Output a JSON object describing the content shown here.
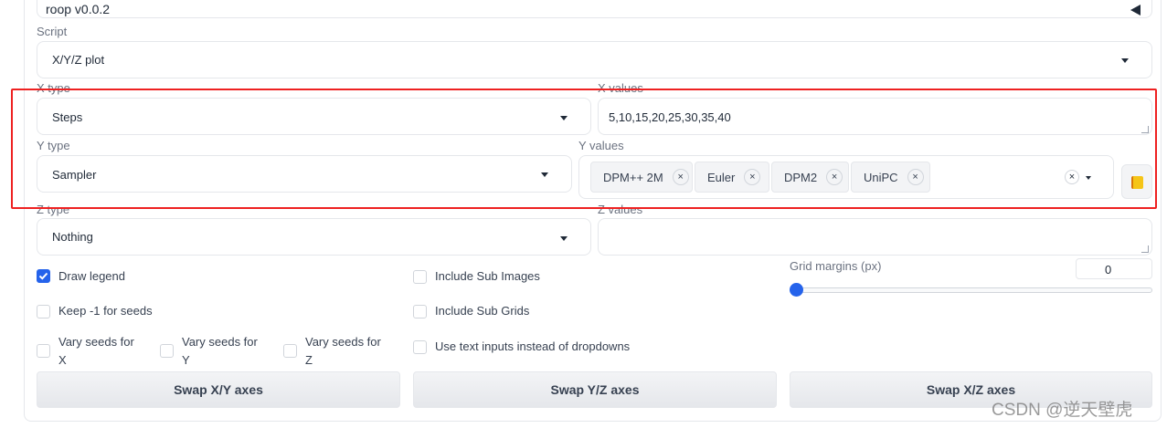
{
  "roop": {
    "label": "roop v0.0.2"
  },
  "script": {
    "label": "Script",
    "value": "X/Y/Z plot"
  },
  "x": {
    "type_label": "X type",
    "type_value": "Steps",
    "values_label": "X values",
    "values_value": "5,10,15,20,25,30,35,40"
  },
  "y": {
    "type_label": "Y type",
    "type_value": "Sampler",
    "values_label": "Y values",
    "chips": [
      "DPM++ 2M",
      "Euler",
      "DPM2",
      "UniPC"
    ],
    "chip_remove": "×",
    "clear": "×"
  },
  "z": {
    "type_label": "Z type",
    "type_value": "Nothing",
    "values_label": "Z values",
    "values_value": ""
  },
  "options": {
    "draw_legend": {
      "label": "Draw legend",
      "checked": true
    },
    "include_sub_images": {
      "label": "Include Sub Images",
      "checked": false
    },
    "keep_seeds": {
      "label": "Keep -1 for seeds",
      "checked": false
    },
    "include_sub_grids": {
      "label": "Include Sub Grids",
      "checked": false
    },
    "vary_x": {
      "label_1": "Vary seeds for",
      "label_2": "X",
      "checked": false
    },
    "vary_y": {
      "label_1": "Vary seeds for",
      "label_2": "Y",
      "checked": false
    },
    "vary_z": {
      "label_1": "Vary seeds for",
      "label_2": "Z",
      "checked": false
    },
    "text_inputs": {
      "label": "Use text inputs instead of dropdowns",
      "checked": false
    }
  },
  "grid_margins": {
    "label": "Grid margins (px)",
    "value": "0",
    "slider_fraction": 0
  },
  "buttons": {
    "swap_xy": "Swap X/Y axes",
    "swap_yz": "Swap Y/Z axes",
    "swap_xz": "Swap X/Z axes"
  },
  "watermark": "CSDN @逆天壁虎",
  "colors": {
    "accent": "#2563eb",
    "highlight": "#ee2121"
  }
}
